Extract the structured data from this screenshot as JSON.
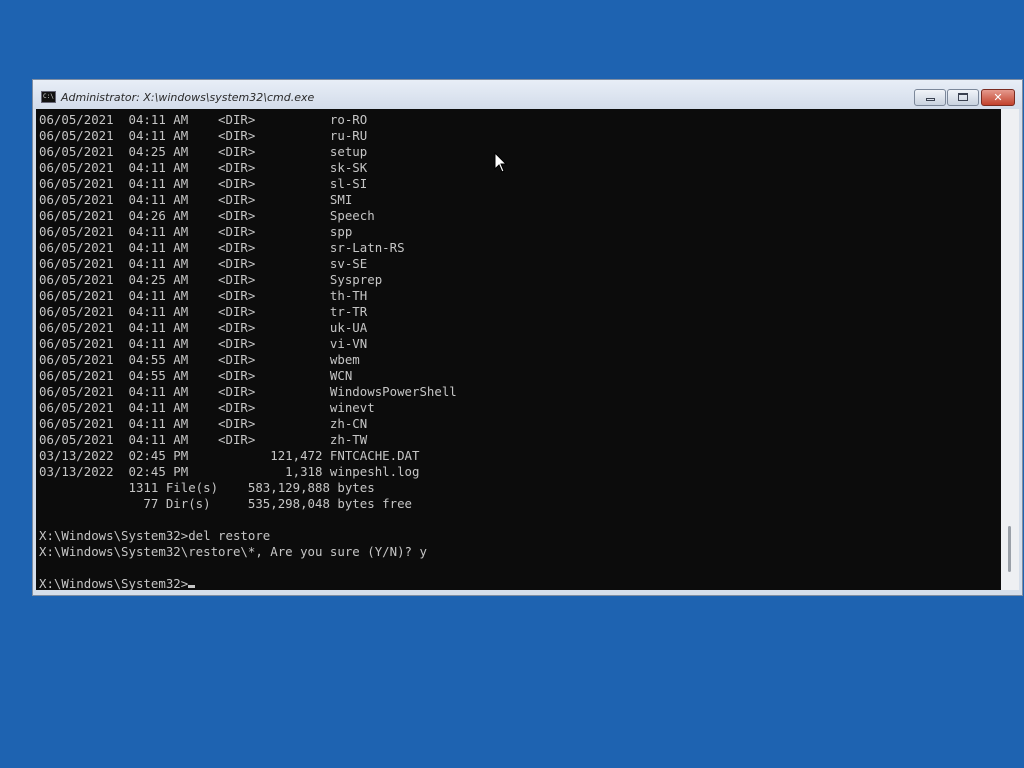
{
  "window": {
    "title": "Administrator: X:\\windows\\system32\\cmd.exe",
    "icon_text": "C:\\",
    "controls": {
      "minimize": "minimize",
      "maximize": "maximize",
      "close": "✕"
    }
  },
  "console": {
    "lines": [
      "06/05/2021  04:11 AM    <DIR>          ro-RO",
      "06/05/2021  04:11 AM    <DIR>          ru-RU",
      "06/05/2021  04:25 AM    <DIR>          setup",
      "06/05/2021  04:11 AM    <DIR>          sk-SK",
      "06/05/2021  04:11 AM    <DIR>          sl-SI",
      "06/05/2021  04:11 AM    <DIR>          SMI",
      "06/05/2021  04:26 AM    <DIR>          Speech",
      "06/05/2021  04:11 AM    <DIR>          spp",
      "06/05/2021  04:11 AM    <DIR>          sr-Latn-RS",
      "06/05/2021  04:11 AM    <DIR>          sv-SE",
      "06/05/2021  04:25 AM    <DIR>          Sysprep",
      "06/05/2021  04:11 AM    <DIR>          th-TH",
      "06/05/2021  04:11 AM    <DIR>          tr-TR",
      "06/05/2021  04:11 AM    <DIR>          uk-UA",
      "06/05/2021  04:11 AM    <DIR>          vi-VN",
      "06/05/2021  04:55 AM    <DIR>          wbem",
      "06/05/2021  04:55 AM    <DIR>          WCN",
      "06/05/2021  04:11 AM    <DIR>          WindowsPowerShell",
      "06/05/2021  04:11 AM    <DIR>          winevt",
      "06/05/2021  04:11 AM    <DIR>          zh-CN",
      "06/05/2021  04:11 AM    <DIR>          zh-TW",
      "03/13/2022  02:45 PM           121,472 FNTCACHE.DAT",
      "03/13/2022  02:45 PM             1,318 winpeshl.log",
      "            1311 File(s)    583,129,888 bytes",
      "              77 Dir(s)     535,298,048 bytes free",
      "",
      "X:\\Windows\\System32>del restore",
      "X:\\Windows\\System32\\restore\\*, Are you sure (Y/N)? y",
      ""
    ],
    "prompt": "X:\\Windows\\System32>"
  }
}
